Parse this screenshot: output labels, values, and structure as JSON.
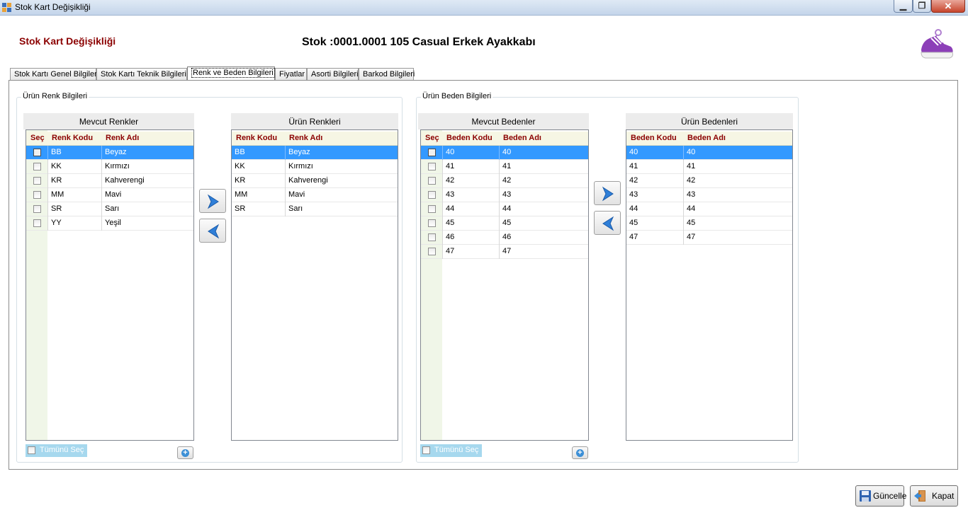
{
  "window": {
    "title": "Stok Kart Değişikliği"
  },
  "header": {
    "title": "Stok Kart Değişikliği",
    "stock_label": "Stok :0001.0001 105 Casual Erkek Ayakkabı"
  },
  "tabs": [
    {
      "label": "Stok Kartı Genel Bilgiler"
    },
    {
      "label": "Stok Kartı Teknik Bilgileri"
    },
    {
      "label": "Renk ve Beden Bilgileri"
    },
    {
      "label": "Fiyatlar"
    },
    {
      "label": "Asorti Bilgileri"
    },
    {
      "label": "Barkod Bilgileri"
    }
  ],
  "color_group": {
    "title": "Ürün Renk Bilgileri",
    "available": {
      "title": "Mevcut Renkler",
      "columns": {
        "select": "Seç",
        "code": "Renk Kodu",
        "name": "Renk Adı"
      },
      "rows": [
        {
          "code": "BB",
          "name": "Beyaz"
        },
        {
          "code": "KK",
          "name": "Kırmızı"
        },
        {
          "code": "KR",
          "name": "Kahverengi"
        },
        {
          "code": "MM",
          "name": "Mavi"
        },
        {
          "code": "SR",
          "name": "Sarı"
        },
        {
          "code": "YY",
          "name": "Yeşil"
        }
      ]
    },
    "product": {
      "title": "Ürün Renkleri",
      "columns": {
        "code": "Renk Kodu",
        "name": "Renk Adı"
      },
      "rows": [
        {
          "code": "BB",
          "name": "Beyaz"
        },
        {
          "code": "KK",
          "name": "Kırmızı"
        },
        {
          "code": "KR",
          "name": "Kahverengi"
        },
        {
          "code": "MM",
          "name": "Mavi"
        },
        {
          "code": "SR",
          "name": "Sarı"
        }
      ]
    },
    "select_all": "Tümünü Seç"
  },
  "size_group": {
    "title": "Ürün Beden Bilgileri",
    "available": {
      "title": "Mevcut Bedenler",
      "columns": {
        "select": "Seç",
        "code": "Beden Kodu",
        "name": "Beden Adı"
      },
      "rows": [
        {
          "code": "40",
          "name": "40"
        },
        {
          "code": "41",
          "name": "41"
        },
        {
          "code": "42",
          "name": "42"
        },
        {
          "code": "43",
          "name": "43"
        },
        {
          "code": "44",
          "name": "44"
        },
        {
          "code": "45",
          "name": "45"
        },
        {
          "code": "46",
          "name": "46"
        },
        {
          "code": "47",
          "name": "47"
        }
      ]
    },
    "product": {
      "title": "Ürün Bedenleri",
      "columns": {
        "code": "Beden Kodu",
        "name": "Beden Adı"
      },
      "rows": [
        {
          "code": "40",
          "name": "40"
        },
        {
          "code": "41",
          "name": "41"
        },
        {
          "code": "42",
          "name": "42"
        },
        {
          "code": "43",
          "name": "43"
        },
        {
          "code": "44",
          "name": "44"
        },
        {
          "code": "45",
          "name": "45"
        },
        {
          "code": "47",
          "name": "47"
        }
      ]
    },
    "select_all": "Tümünü Seç"
  },
  "footer": {
    "update_label": "Güncelle",
    "close_label": "Kapat"
  },
  "colors": {
    "accent_selected": "#3399ff",
    "header_text": "#8b0000"
  }
}
